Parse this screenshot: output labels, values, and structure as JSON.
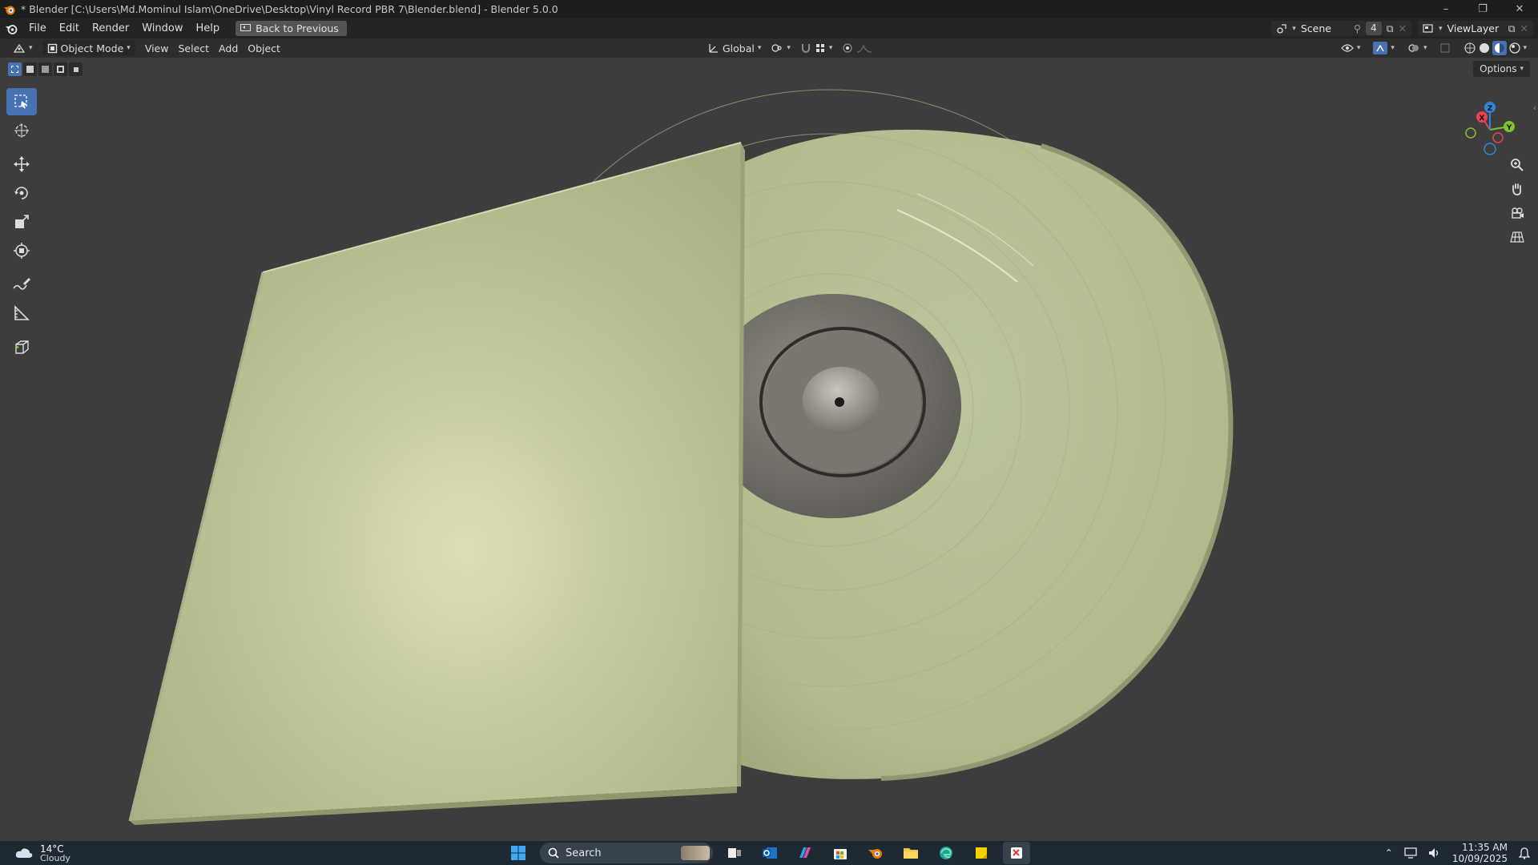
{
  "window": {
    "title": "* Blender [C:\\Users\\Md.Mominul Islam\\OneDrive\\Desktop\\Vinyl Record PBR 7\\Blender.blend] - Blender 5.0.0",
    "minimize_glyph": "–",
    "maximize_glyph": "❐",
    "close_glyph": "✕"
  },
  "menu": {
    "file": "File",
    "edit": "Edit",
    "render": "Render",
    "window": "Window",
    "help": "Help",
    "back_button": "Back to Previous"
  },
  "topbar_right": {
    "scene_label": "Scene",
    "scene_users": "4",
    "viewlayer_label": "ViewLayer"
  },
  "header": {
    "mode": "Object Mode",
    "view": "View",
    "select": "Select",
    "add": "Add",
    "object": "Object",
    "transform_orientation": "Global",
    "options": "Options"
  },
  "gizmo": {
    "x": "X",
    "y": "Y",
    "z": "Z",
    "colors": {
      "x": "#e8434f",
      "y": "#7fc52a",
      "z": "#2f84e0"
    }
  },
  "scene_colors": {
    "viewport_bg": "#3d3d3d",
    "material": "#b6be93",
    "label_metal": "#7d7a74"
  },
  "taskbar": {
    "temperature": "14°C",
    "condition": "Cloudy",
    "search_placeholder": "Search",
    "time": "11:35 AM",
    "date": "10/09/2025"
  }
}
